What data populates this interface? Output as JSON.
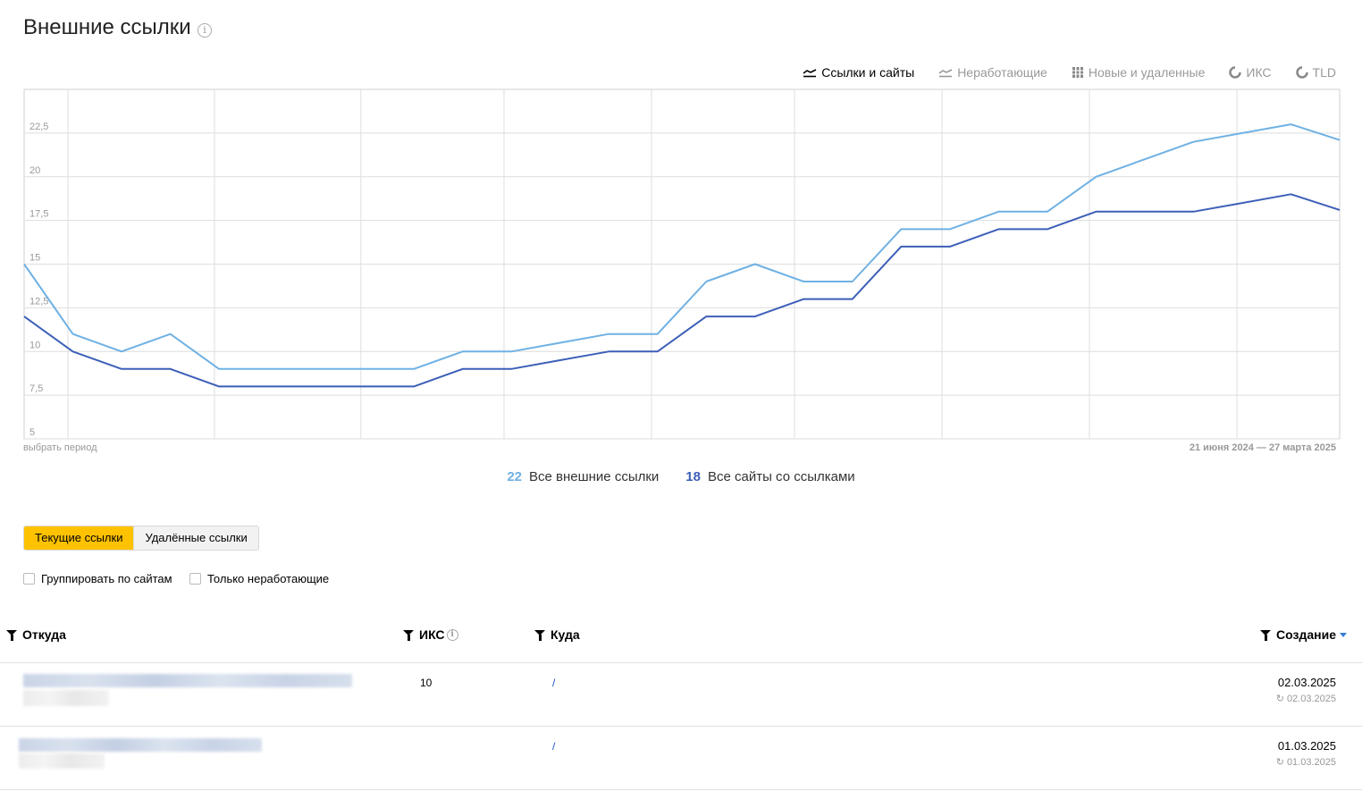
{
  "header": {
    "title": "Внешние ссылки",
    "info_icon": "info-icon"
  },
  "tabs": [
    {
      "label": "Ссылки и сайты",
      "icon": "line-chart-icon",
      "active": true
    },
    {
      "label": "Неработающие",
      "icon": "line-chart-icon",
      "active": false
    },
    {
      "label": "Новые и удаленные",
      "icon": "bar-chart-icon",
      "active": false
    },
    {
      "label": "ИКС",
      "icon": "pie-chart-icon",
      "active": false
    },
    {
      "label": "TLD",
      "icon": "pie-chart-icon",
      "active": false
    }
  ],
  "chart_data": {
    "type": "line",
    "y_ticks": [
      "5",
      "7,5",
      "10",
      "12,5",
      "15",
      "17,5",
      "20",
      "22,5"
    ],
    "ylim": [
      5,
      25
    ],
    "grid": true,
    "series": [
      {
        "name": "Все внешние ссылки",
        "color": "#6fb1e4",
        "values": [
          15,
          11,
          10,
          11,
          9,
          9,
          9,
          9,
          9,
          10,
          10,
          10.5,
          11,
          11,
          14,
          15,
          14,
          14,
          17,
          17,
          18,
          18,
          20,
          21,
          22,
          22.5,
          23,
          22.1
        ]
      },
      {
        "name": "Все сайты со ссылками",
        "color": "#3d5fb8",
        "values": [
          12,
          10,
          9,
          9,
          8,
          8,
          8,
          8,
          8,
          9,
          9,
          9.5,
          10,
          10,
          12,
          12,
          13,
          13,
          16,
          16,
          17,
          17,
          18,
          18,
          18,
          18.5,
          19,
          18.1
        ]
      }
    ]
  },
  "chart_footer": {
    "period_link": "выбрать период",
    "date_range": "21 июня 2024 — 27 марта 2025"
  },
  "legend": [
    {
      "value": "22",
      "label": "Все внешние ссылки",
      "color": "#6fb1e4"
    },
    {
      "value": "18",
      "label": "Все сайты со ссылками",
      "color": "#3d5fb8"
    }
  ],
  "segmented": {
    "current": "Текущие ссылки",
    "deleted": "Удалённые ссылки"
  },
  "filters": {
    "group_by_sites": "Группировать по сайтам",
    "only_broken": "Только неработающие"
  },
  "table": {
    "headers": {
      "from": "Откуда",
      "iks": "ИКС",
      "to": "Куда",
      "created": "Создание"
    },
    "rows": [
      {
        "iks": "10",
        "to": "/",
        "created": "02.03.2025",
        "updated": "02.03.2025"
      },
      {
        "iks": "",
        "to": "/",
        "created": "01.03.2025",
        "updated": "01.03.2025"
      }
    ]
  },
  "colors": {
    "accent": "#ffc200",
    "series_light": "#6fb1e4",
    "series_dark": "#3d5fb8"
  }
}
